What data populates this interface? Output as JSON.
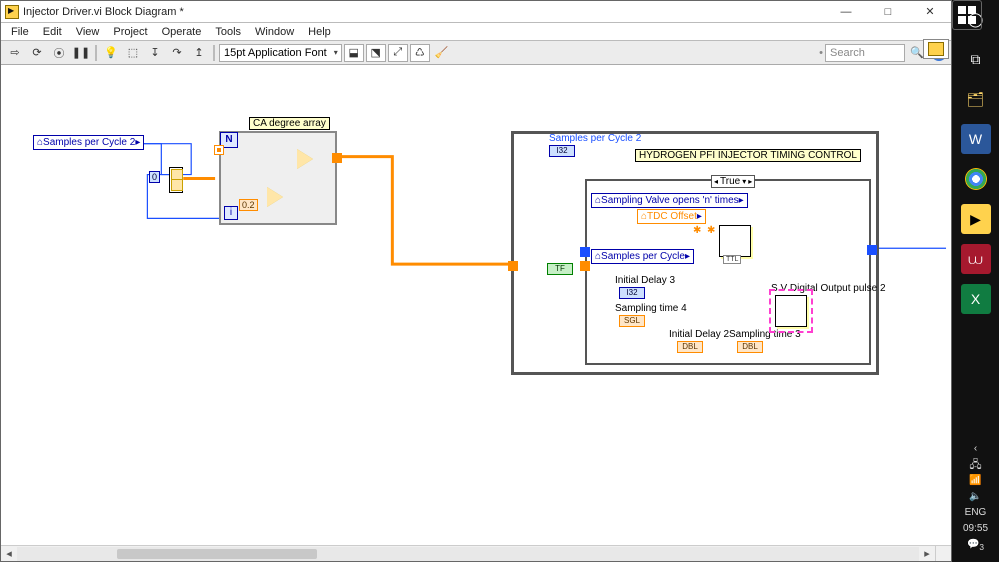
{
  "window": {
    "title": "Injector Driver.vi Block Diagram *",
    "min": "—",
    "max": "□",
    "close": "✕"
  },
  "menu": [
    "File",
    "Edit",
    "View",
    "Project",
    "Operate",
    "Tools",
    "Window",
    "Help"
  ],
  "toolbar": {
    "font": "15pt Application Font",
    "search_placeholder": "Search"
  },
  "diagram": {
    "ctrl_samples_cycle2": "Samples per Cycle 2",
    "const_zero": "0",
    "const_step": "0.2",
    "label_ca_array": "CA degree array",
    "seq_title": "HYDROGEN PFI INJECTOR TIMING CONTROL",
    "lbl_samples_cycle2_top": "Samples per Cycle 2",
    "term_i32": "I32",
    "term_tf": "TF",
    "case_value": "True",
    "ctrl_sv_opens": "Sampling Valve opens 'n' times",
    "ctrl_tdc": "TDC Offset",
    "ctrl_samples_cycle": "Samples per Cycle",
    "lbl_initial_delay3": "Initial Delay 3",
    "lbl_sampling_time4": "Sampling time 4",
    "lbl_initial_delay2": "Initial Delay 2",
    "lbl_sampling_time3": "Sampling time 3",
    "lbl_sv_output": "S.V Digital Output pulse 2",
    "term_dbl": "DBL",
    "term_sgl": "SGL",
    "subvi_cap": "TTL",
    "loop_N": "N",
    "loop_i": "i"
  },
  "tray": {
    "chevron": "‹",
    "wifi": "⇪",
    "net": "🖧",
    "vol": "🔈",
    "lang": "ENG",
    "clock": "09:55",
    "notif": "3"
  }
}
